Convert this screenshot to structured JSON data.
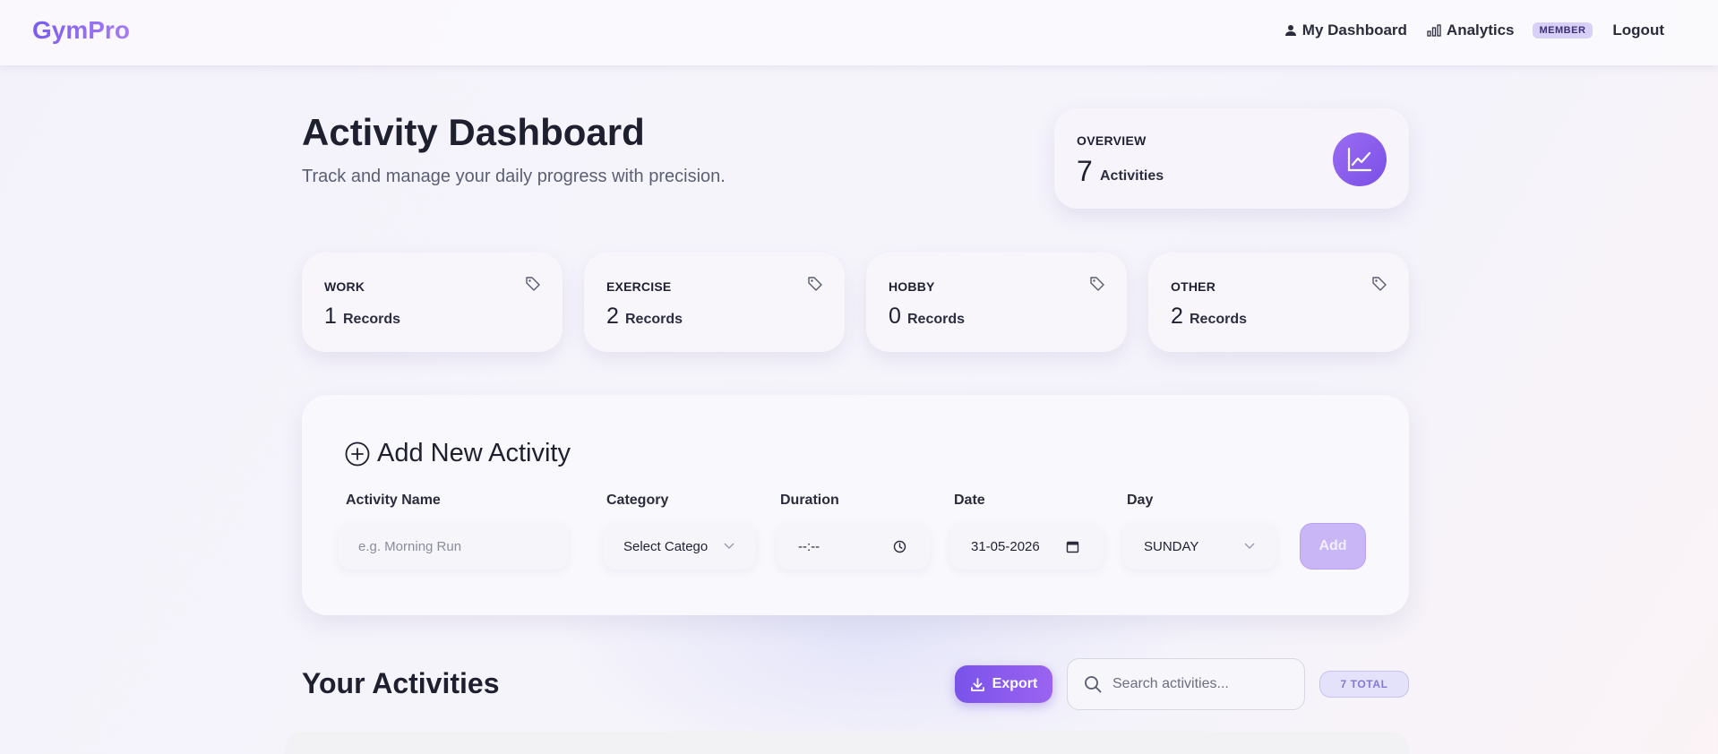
{
  "nav": {
    "brand": "GymPro",
    "links": {
      "dashboard": "My Dashboard",
      "analytics": "Analytics",
      "logout": "Logout"
    },
    "member_badge": "MEMBER"
  },
  "header": {
    "title": "Activity Dashboard",
    "subtitle": "Track and manage your daily progress with precision."
  },
  "overview": {
    "label": "OVERVIEW",
    "count": "7",
    "unit": "Activities"
  },
  "stats": [
    {
      "label": "WORK",
      "count": "1",
      "unit": "Records"
    },
    {
      "label": "EXERCISE",
      "count": "2",
      "unit": "Records"
    },
    {
      "label": "HOBBY",
      "count": "0",
      "unit": "Records"
    },
    {
      "label": "OTHER",
      "count": "2",
      "unit": "Records"
    }
  ],
  "add_form": {
    "title": "Add New Activity",
    "labels": {
      "name": "Activity Name",
      "category": "Category",
      "duration": "Duration",
      "date": "Date",
      "day": "Day"
    },
    "name_placeholder": "e.g. Morning Run",
    "category_value": "Select Catego",
    "duration_value": "--:--",
    "date_value": "31-05-2026",
    "day_value": "SUNDAY",
    "add_label": "Add"
  },
  "activities": {
    "title": "Your Activities",
    "export_label": "Export",
    "search_placeholder": "Search activities...",
    "total_badge": "7 TOTAL"
  },
  "colors": {
    "accent": "#7b5cf0",
    "accent_light": "#c9b6f6",
    "badge_bg": "#d8d0f6"
  },
  "icons": [
    "user-icon",
    "bar-chart-icon",
    "trend-chart-icon",
    "tag-icon",
    "plus-circle-icon",
    "chevron-down-icon",
    "clock-icon",
    "calendar-icon",
    "download-icon",
    "search-icon"
  ]
}
